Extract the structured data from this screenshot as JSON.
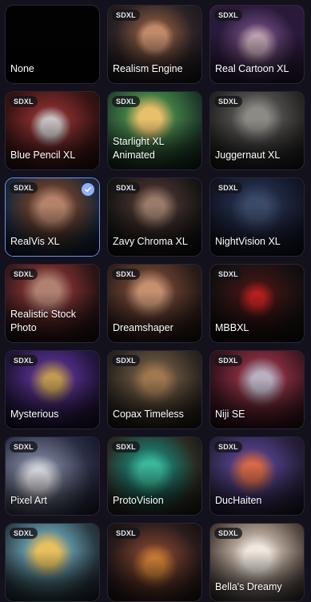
{
  "models": [
    {
      "label": "None",
      "badge": "",
      "art": "none"
    },
    {
      "label": "Realism Engine",
      "badge": "SDXL",
      "art": "realism"
    },
    {
      "label": "Real Cartoon XL",
      "badge": "SDXL",
      "art": "cartoon"
    },
    {
      "label": "Blue Pencil XL",
      "badge": "SDXL",
      "art": "bluepencil"
    },
    {
      "label": "Starlight XL Animated",
      "badge": "SDXL",
      "art": "starlight"
    },
    {
      "label": "Juggernaut XL",
      "badge": "SDXL",
      "art": "juggernaut"
    },
    {
      "label": "RealVis XL",
      "badge": "SDXL",
      "art": "realvis",
      "selected": true
    },
    {
      "label": "Zavy Chroma XL",
      "badge": "SDXL",
      "art": "zavy"
    },
    {
      "label": "NightVision XL",
      "badge": "SDXL",
      "art": "nightvision"
    },
    {
      "label": "Realistic Stock Photo",
      "badge": "SDXL",
      "art": "stock"
    },
    {
      "label": "Dreamshaper",
      "badge": "SDXL",
      "art": "dreamshaper"
    },
    {
      "label": "MBBXL",
      "badge": "SDXL",
      "art": "mbbxl"
    },
    {
      "label": "Mysterious",
      "badge": "SDXL",
      "art": "mysterious"
    },
    {
      "label": "Copax Timeless",
      "badge": "SDXL",
      "art": "copax"
    },
    {
      "label": "Niji SE",
      "badge": "SDXL",
      "art": "niji"
    },
    {
      "label": "Pixel Art",
      "badge": "SDXL",
      "art": "pixel"
    },
    {
      "label": "ProtoVision",
      "badge": "SDXL",
      "art": "protovision"
    },
    {
      "label": "DucHaiten",
      "badge": "SDXL",
      "art": "duchaiten"
    },
    {
      "label": "",
      "badge": "SDXL",
      "art": "row7a"
    },
    {
      "label": "",
      "badge": "SDXL",
      "art": "row7b"
    },
    {
      "label": "Bella's Dreamy",
      "badge": "SDXL",
      "art": "bella"
    }
  ],
  "selected_check_icon": "check-icon",
  "colors": {
    "background": "#13111c",
    "selected_border": "#6a93ff",
    "check_fill": "#8fb0ff"
  }
}
